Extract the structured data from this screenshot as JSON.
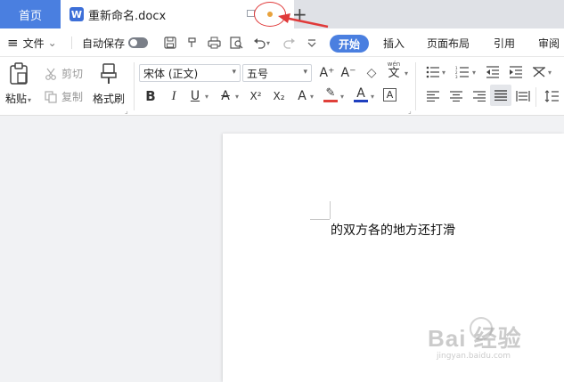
{
  "tabs": {
    "home_label": "首页",
    "doc_icon_letter": "W",
    "doc_title": "重新命名.docx",
    "new_tab_symbol": "+"
  },
  "menu": {
    "hamburger": "≡",
    "file_label": "文件",
    "file_caret": "⌄",
    "autosave_label": "自动保存",
    "quick_access": [
      "save-icon",
      "format-painter-icon",
      "print-icon",
      "print-preview-icon",
      "undo-icon",
      "redo-icon",
      "customize-icon"
    ],
    "tab_start": "开始",
    "tab_insert": "插入",
    "tab_layout": "页面布局",
    "tab_references": "引用",
    "tab_review": "审阅"
  },
  "ribbon": {
    "paste_label": "粘贴",
    "cut_label": "剪切",
    "copy_label": "复制",
    "format_painter_label": "格式刷",
    "font_name": "宋体 (正文)",
    "font_size": "五号",
    "bold": "B",
    "italic": "I",
    "underline": "U",
    "strike": "A",
    "superscript": "X²",
    "subscript": "X₂",
    "text_effect": "A",
    "highlight": "✎",
    "font_color": "A",
    "char_border": "A",
    "grow_font": "A⁺",
    "shrink_font": "A⁻",
    "clear_format": "◇",
    "phonetic": "文",
    "phonetic_small": "wén"
  },
  "document": {
    "body_text": "的双方各的地方还打滑"
  },
  "watermark": {
    "brand": "Bai 经验",
    "url": "jingyan.baidu.com"
  },
  "colors": {
    "accent": "#4a7fe0",
    "annotation_red": "#e03a3a",
    "modified_dot": "#e8a23c",
    "font_color_bar": "#1f3fbf",
    "highlight_bar": "#e0403a"
  }
}
